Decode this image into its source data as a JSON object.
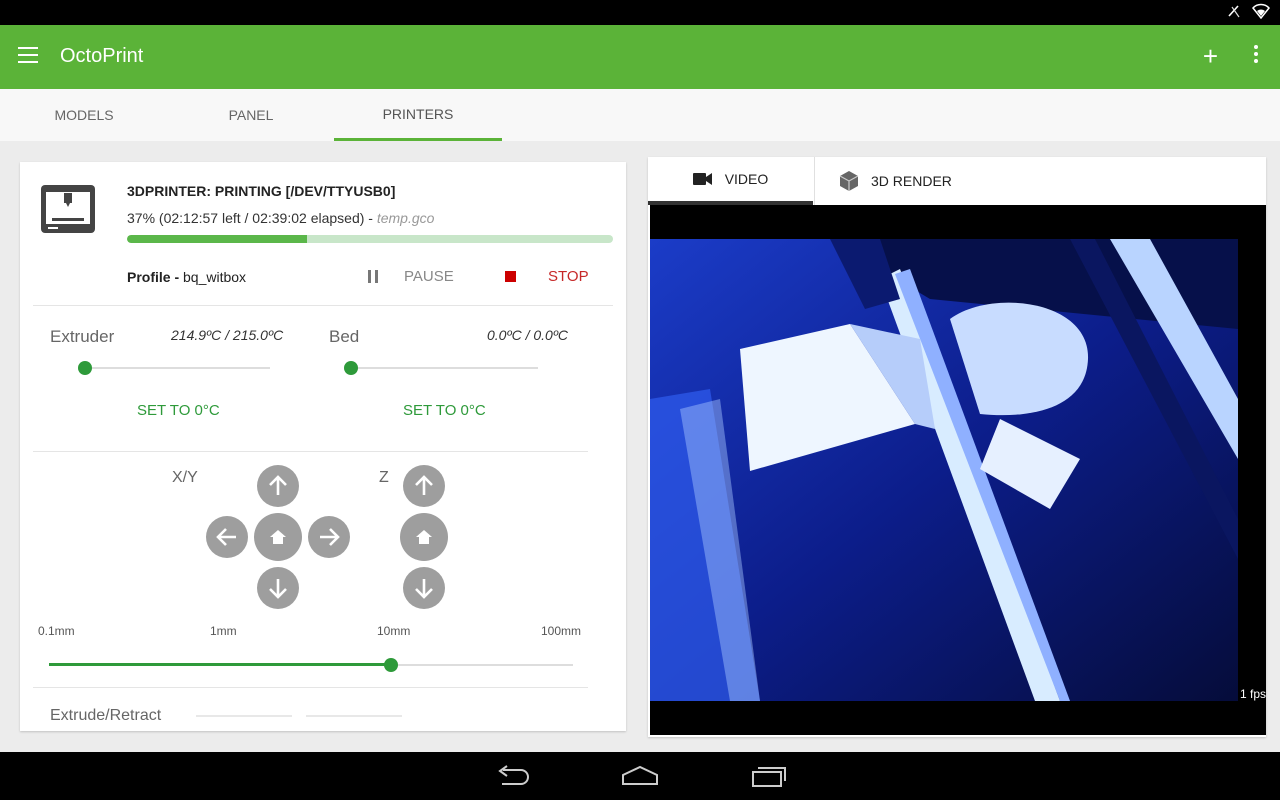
{
  "app": {
    "title": "OctoPrint"
  },
  "tabs": [
    {
      "label": "MODELS"
    },
    {
      "label": "PANEL"
    },
    {
      "label": "PRINTERS",
      "active": true
    }
  ],
  "printer": {
    "name": "3DPRINTER: PRINTING [/DEV/TTYUSB0]",
    "progress_summary": "37% (02:12:57 left / 02:39:02 elapsed) - ",
    "file": "temp.gco",
    "progress_percent": 37,
    "profile_label": "Profile - ",
    "profile_value": "bq_witbox",
    "pause_label": "PAUSE",
    "stop_label": "STOP"
  },
  "temperatures": {
    "extruder": {
      "label": "Extruder",
      "value": "214.9ºC / 215.0ºC",
      "set_label": "SET TO 0°C",
      "slider_fraction": 0
    },
    "bed": {
      "label": "Bed",
      "value": "0.0ºC / 0.0ºC",
      "set_label": "SET TO 0°C",
      "slider_fraction": 0
    }
  },
  "movement": {
    "xy_label": "X/Y",
    "z_label": "Z",
    "steps": [
      "0.1mm",
      "1mm",
      "10mm",
      "100mm"
    ],
    "selected_step": "10mm"
  },
  "extrude": {
    "label": "Extrude/Retract"
  },
  "camera": {
    "tabs": [
      {
        "label": "VIDEO",
        "icon": "video-camera-icon",
        "active": true
      },
      {
        "label": "3D RENDER",
        "icon": "cube-icon"
      }
    ],
    "fps_label": "1 fps"
  },
  "colors": {
    "accent": "#5bb338",
    "action": "#2e9a3a",
    "stop": "#c62828"
  }
}
